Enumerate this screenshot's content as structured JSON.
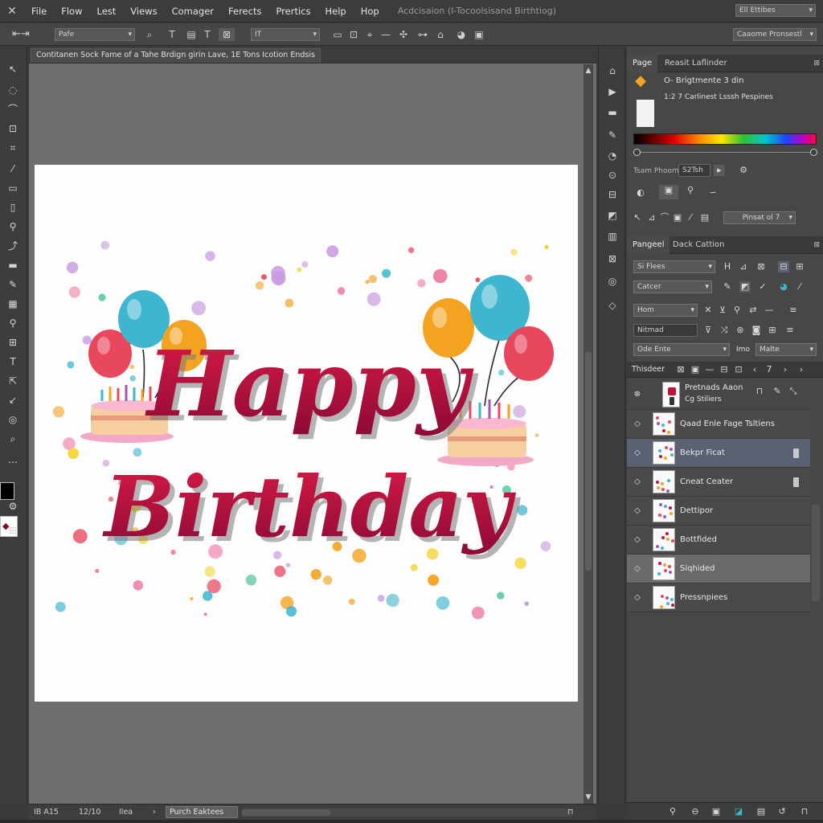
{
  "menubar": {
    "logo_icon": "app-logo-icon",
    "items": [
      "File",
      "Flow",
      "Lest",
      "Views",
      "Comager",
      "Ferects",
      "Prertics",
      "Help",
      "Hop"
    ],
    "doc_title": "Acdcisaion (I-Tocoolsisand Birthtiog)",
    "right_dropdown": "Ell Ettibes"
  },
  "options_bar": {
    "preset": "Pafe",
    "size_field": "IT",
    "right_dropdown": "Caaome Pronsestl"
  },
  "document": {
    "tab_title": "Contitanen Sock Fame of a Tahe Brdign girin Lave, 1E Tons Icotion Endsis",
    "artwork": {
      "line1": "Happy",
      "line2": "Birthday",
      "colors": {
        "text": "#c0143c",
        "text_dark": "#8c0a36",
        "shadow": "#6a6a6a",
        "balloon_blue": "#3fb6cf",
        "balloon_orange": "#f4a321",
        "balloon_red": "#e9475e"
      }
    }
  },
  "status_bar": {
    "zoom": "IB A15",
    "size": "12/10",
    "mode": "Ilea",
    "dropdown": "Purch Eaktees"
  },
  "color_panel": {
    "tabs": [
      "Page",
      "Reasit Laflinder"
    ],
    "line1": "O- Brigtmente 3 din",
    "line2": "1:2 7 Carlinest Lsssh Pespines",
    "field_label": "Tsam Phoom",
    "field_value": "S2Tsh",
    "button_label": "Pinsat ol 7"
  },
  "properties_panel": {
    "tabs": [
      "Pangeel",
      "Dack Cattion"
    ],
    "font_family": "Si Flees",
    "font_style": "Catcer",
    "size": "Hom",
    "tracking": "Nitmad",
    "blend": "Ode Ente",
    "opacity_label": "Imo",
    "opacity_value": "Malte"
  },
  "layers_panel": {
    "title": "Thisdeer",
    "group_line1": "Pretnads Aaon",
    "group_line2": "Cg Stiliers",
    "layers": [
      {
        "name": "Qaad Enle Fage Tsltiens",
        "state": "normal",
        "locked": false
      },
      {
        "name": "Bekpr Ficat",
        "state": "selected",
        "locked": true
      },
      {
        "name": "Cneat Ceater",
        "state": "normal",
        "locked": true
      },
      {
        "name": "Dettipor",
        "state": "normal",
        "locked": false
      },
      {
        "name": "Bottfided",
        "state": "normal",
        "locked": false
      },
      {
        "name": "Siqhided",
        "state": "highlight",
        "locked": false
      },
      {
        "name": "Pressnpiees",
        "state": "normal",
        "locked": false
      }
    ]
  }
}
